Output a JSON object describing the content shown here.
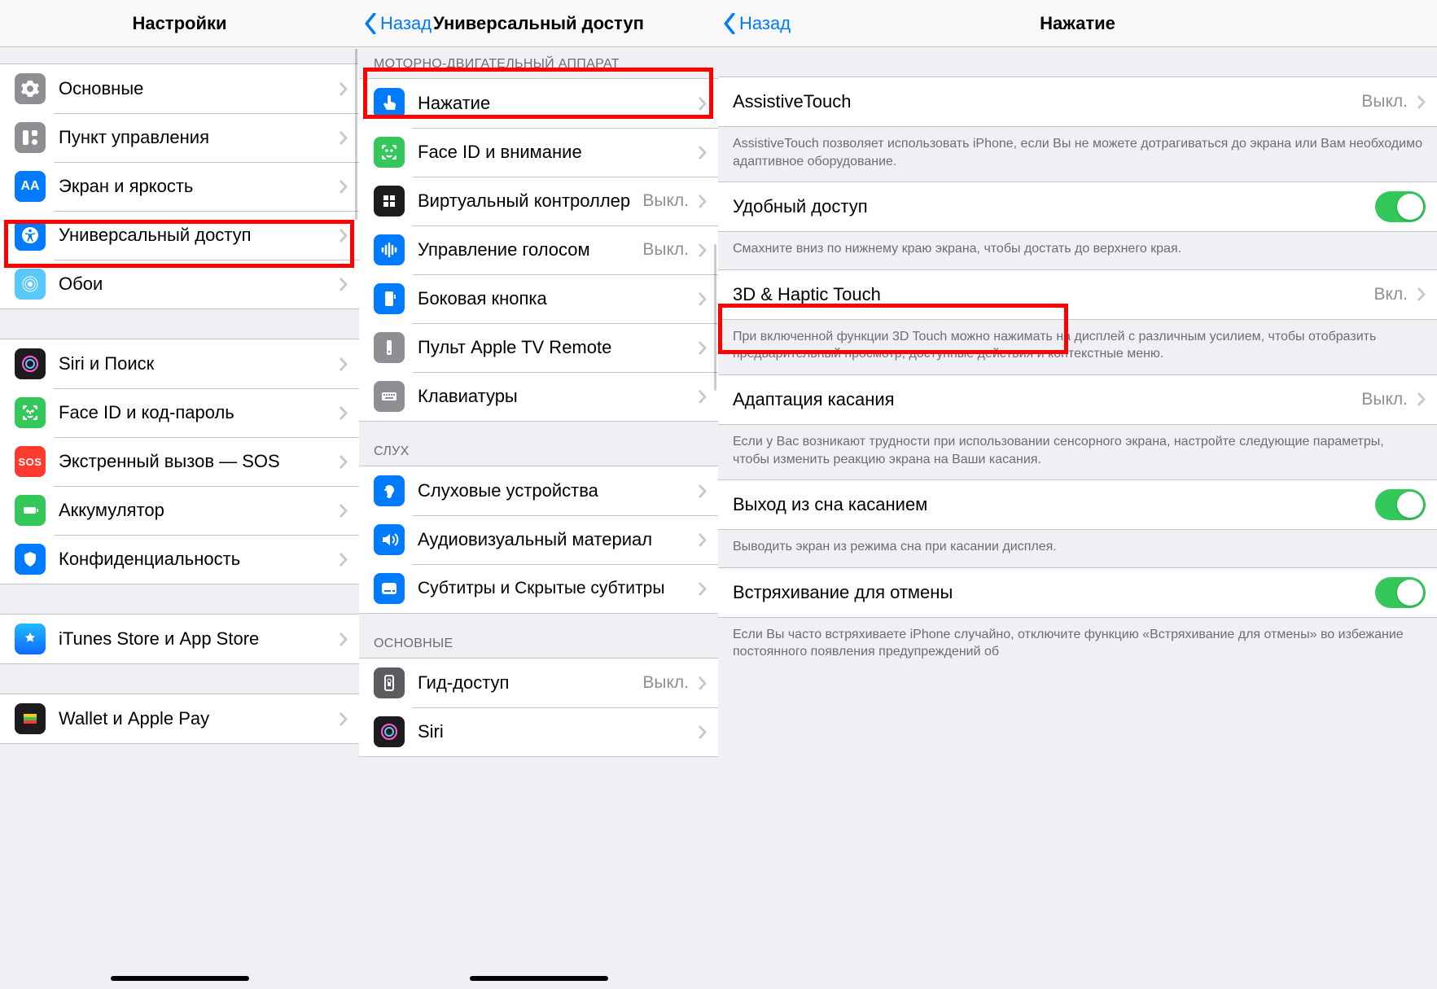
{
  "pane1": {
    "title": "Настройки",
    "items": [
      {
        "label": "Основные"
      },
      {
        "label": "Пункт управления"
      },
      {
        "label": "Экран и яркость"
      },
      {
        "label": "Универсальный доступ"
      },
      {
        "label": "Обои"
      }
    ],
    "items2": [
      {
        "label": "Siri и Поиск"
      },
      {
        "label": "Face ID и код-пароль"
      },
      {
        "label": "Экстренный вызов — SOS"
      },
      {
        "label": "Аккумулятор"
      },
      {
        "label": "Конфиденциальность"
      }
    ],
    "items3": [
      {
        "label": "iTunes Store и App Store"
      }
    ],
    "items4": [
      {
        "label": "Wallet и Apple Pay"
      }
    ]
  },
  "pane2": {
    "back": "Назад",
    "title": "Универсальный доступ",
    "sec1_header": "МОТОРНО-ДВИГАТЕЛЬНЫЙ АППАРАТ",
    "sec1": [
      {
        "label": "Нажатие",
        "value": ""
      },
      {
        "label": "Face ID и внимание",
        "value": ""
      },
      {
        "label": "Виртуальный контроллер",
        "value": "Выкл."
      },
      {
        "label": "Управление голосом",
        "value": "Выкл."
      },
      {
        "label": "Боковая кнопка",
        "value": ""
      },
      {
        "label": "Пульт Apple TV Remote",
        "value": ""
      },
      {
        "label": "Клавиатуры",
        "value": ""
      }
    ],
    "sec2_header": "СЛУХ",
    "sec2": [
      {
        "label": "Слуховые устройства",
        "value": ""
      },
      {
        "label": "Аудиовизуальный материал",
        "value": ""
      },
      {
        "label": "Субтитры и Скрытые субтитры",
        "value": ""
      }
    ],
    "sec3_header": "ОСНОВНЫЕ",
    "sec3": [
      {
        "label": "Гид-доступ",
        "value": "Выкл."
      },
      {
        "label": "Siri",
        "value": ""
      }
    ]
  },
  "pane3": {
    "back": "Назад",
    "title": "Нажатие",
    "rows": {
      "assistive": {
        "label": "AssistiveTouch",
        "value": "Выкл."
      },
      "assistive_footer": "AssistiveTouch позволяет использовать iPhone, если Вы не можете дотрагиваться до экрана или Вам необходимо адаптивное оборудование.",
      "reach": {
        "label": "Удобный доступ"
      },
      "reach_footer": "Смахните вниз по нижнему краю экрана, чтобы достать до верхнего края.",
      "hap": {
        "label": "3D & Haptic Touch",
        "value": "Вкл."
      },
      "hap_footer": "При включенной функции 3D Touch можно нажимать на дисплей с различным усилием, чтобы отобразить предварительный просмотр, доступные действия и контекстные меню.",
      "touch_accom": {
        "label": "Адаптация касания",
        "value": "Выкл."
      },
      "touch_accom_footer": "Если у Вас возникают трудности при использовании сенсорного экрана, настройте следующие параметры, чтобы изменить реакцию экрана на Ваши касания.",
      "tap_wake": {
        "label": "Выход из сна касанием"
      },
      "tap_wake_footer": "Выводить экран из режима сна при касании дисплея.",
      "shake": {
        "label": "Встряхивание для отмены"
      },
      "shake_footer": "Если Вы часто встряхиваете iPhone случайно, отключите функцию «Встряхивание для отмены» во избежание постоянного появления предупреждений об"
    }
  }
}
